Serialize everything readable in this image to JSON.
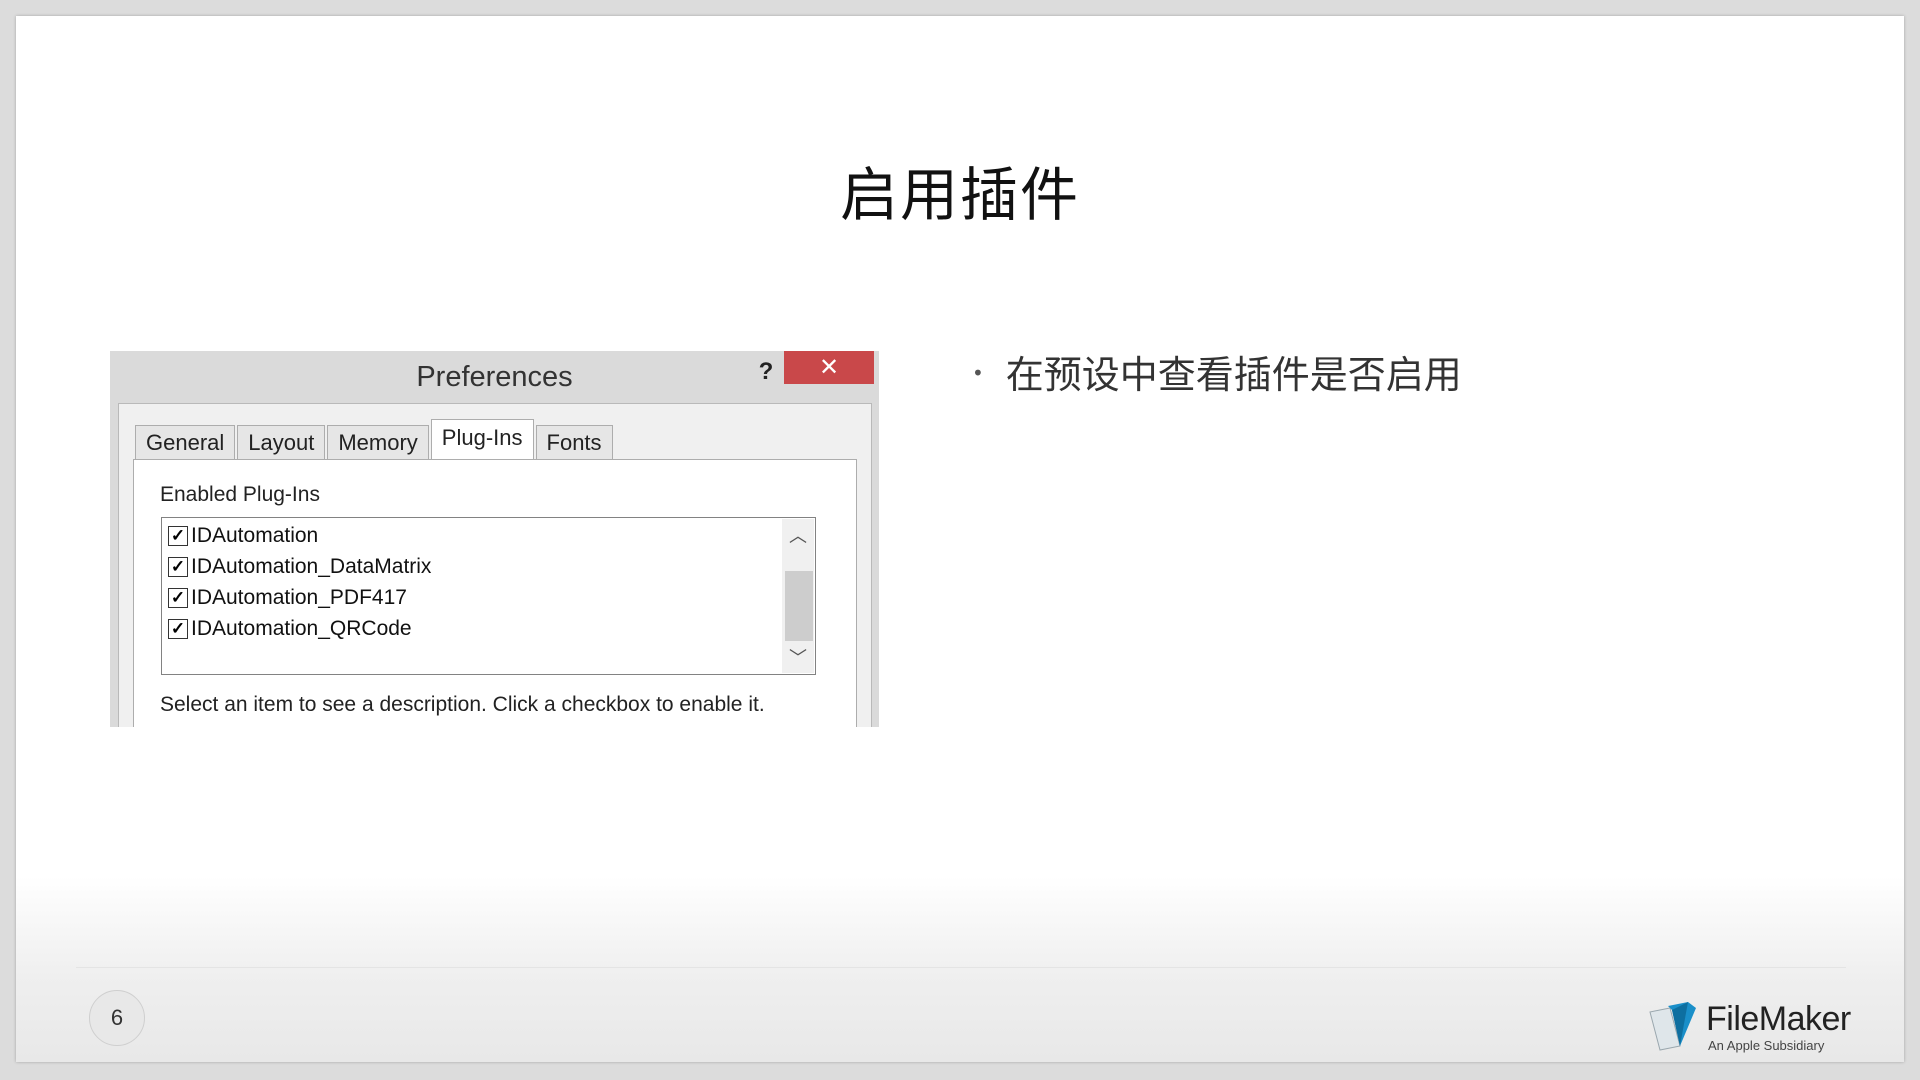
{
  "slide": {
    "title": "启用插件",
    "bullets": [
      "在预设中查看插件是否启用"
    ],
    "page_number": "6"
  },
  "dialog": {
    "title": "Preferences",
    "help_glyph": "?",
    "close_glyph": "✕",
    "tabs": [
      "General",
      "Layout",
      "Memory",
      "Plug-Ins",
      "Fonts"
    ],
    "active_tab": "Plug-Ins",
    "section_label": "Enabled Plug-Ins",
    "plugins": [
      {
        "name": "IDAutomation",
        "enabled": true
      },
      {
        "name": "IDAutomation_DataMatrix",
        "enabled": true
      },
      {
        "name": "IDAutomation_PDF417",
        "enabled": true
      },
      {
        "name": "IDAutomation_QRCode",
        "enabled": true
      }
    ],
    "help_text": "Select an item to see a description.  Click a checkbox to enable it."
  },
  "logo": {
    "name": "FileMaker",
    "tagline": "An Apple Subsidiary"
  },
  "colors": {
    "close_button": "#c9484a",
    "logo_blue": "#1a8fc9"
  },
  "icons": {
    "close": "close-icon",
    "help": "help-icon",
    "scroll_up": "chevron-up-icon",
    "scroll_down": "chevron-down-icon",
    "checkbox": "checkmark-icon",
    "logo": "filemaker-folder-icon"
  }
}
